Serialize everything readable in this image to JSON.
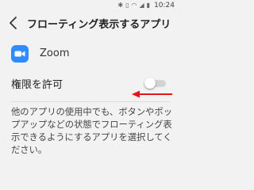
{
  "status_bar": {
    "time": "10:24",
    "icons": [
      "bluetooth-icon",
      "vibrate-icon",
      "wifi-icon",
      "signal-icon",
      "battery-icon"
    ]
  },
  "header": {
    "title": "フローティング表示するアプリ",
    "back_icon": "chevron-left-icon"
  },
  "app": {
    "name": "Zoom",
    "icon": "zoom-app-icon",
    "icon_color": "#2d8cff"
  },
  "permission": {
    "label": "権限を許可",
    "enabled": false
  },
  "annotation": {
    "arrow_color": "#e8141c"
  },
  "description": {
    "lines": [
      "他のアプリの使用中でも、ボタンやポッ",
      "プアップなどの状態でフローティング表",
      "示できるようにするアプリを選択してく",
      "ださい。"
    ]
  }
}
